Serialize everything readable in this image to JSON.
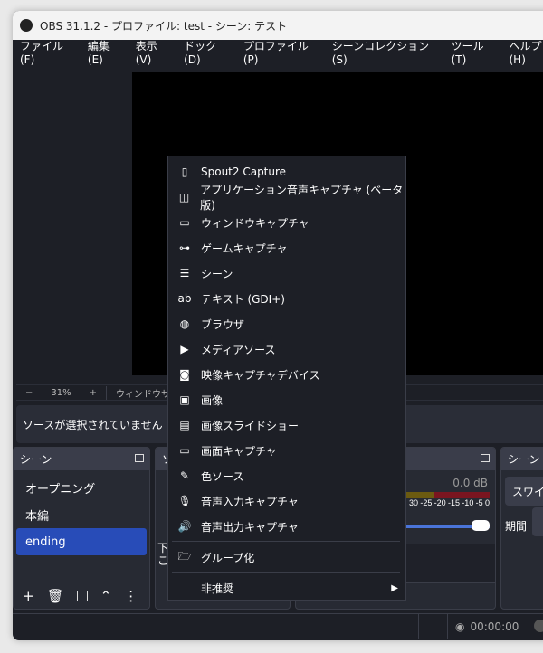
{
  "window": {
    "title": "OBS 31.1.2 - プロファイル: test - シーン: テスト"
  },
  "menubar": [
    "ファイル(F)",
    "編集(E)",
    "表示(V)",
    "ドック(D)",
    "プロファイル(P)",
    "シーンコレクション(S)",
    "ツール(T)",
    "ヘルプ(H)"
  ],
  "zoombar": {
    "minus": "−",
    "zoom": "31%",
    "plus": "+",
    "fit": "ウィンドウサイズに"
  },
  "context": {
    "no_source": "ソースが選択されていません"
  },
  "scenes": {
    "title": "シーン",
    "items": [
      "オープニング",
      "本編",
      "ending"
    ],
    "selected": 2
  },
  "sources": {
    "title": "ソ",
    "hint1": "下",
    "hint2": "こ"
  },
  "mixer": {
    "db": "0.0 dB",
    "ticks": [
      "30",
      "-25",
      "-20",
      "-15",
      "-10",
      "-5",
      "0"
    ],
    "volume": 1.0
  },
  "transitions": {
    "title": "シーント",
    "type": "スワイ",
    "duration_label": "期間"
  },
  "status": {
    "time": "00:00:00"
  },
  "context_menu": {
    "items": [
      {
        "label": "Spout2 Capture",
        "icon": "file-icon"
      },
      {
        "label": "アプリケーション音声キャプチャ (ベータ版)",
        "icon": "app-audio-icon"
      },
      {
        "label": "ウィンドウキャプチャ",
        "icon": "window-icon"
      },
      {
        "label": "ゲームキャプチャ",
        "icon": "gamepad-icon"
      },
      {
        "label": "シーン",
        "icon": "list-icon"
      },
      {
        "label": "テキスト (GDI+)",
        "icon": "text-icon"
      },
      {
        "label": "ブラウザ",
        "icon": "globe-icon"
      },
      {
        "label": "メディアソース",
        "icon": "play-icon"
      },
      {
        "label": "映像キャプチャデバイス",
        "icon": "camera-icon"
      },
      {
        "label": "画像",
        "icon": "image-icon"
      },
      {
        "label": "画像スライドショー",
        "icon": "slideshow-icon"
      },
      {
        "label": "画面キャプチャ",
        "icon": "monitor-icon"
      },
      {
        "label": "色ソース",
        "icon": "brush-icon"
      },
      {
        "label": "音声入力キャプチャ",
        "icon": "microphone-icon"
      },
      {
        "label": "音声出力キャプチャ",
        "icon": "speaker-icon"
      }
    ],
    "group": "グループ化",
    "deprecated": "非推奨"
  },
  "colors": {
    "selected": "#284cb8",
    "meter_green": "#1c6b1c",
    "meter_yellow": "#6b5a10",
    "meter_red": "#7a1520",
    "slider": "#4a74d9"
  }
}
